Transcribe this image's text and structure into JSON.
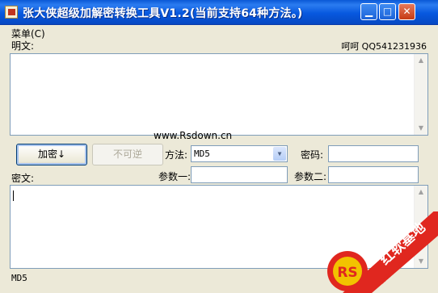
{
  "window": {
    "title": "张大侠超级加解密转换工具V1.2(当前支持64种方法。)"
  },
  "menu": {
    "label": "菜单(C)"
  },
  "plaintext": {
    "label": "明文:",
    "contact": "呵呵 QQ541231936",
    "value": ""
  },
  "watermark": {
    "text": "www.Rsdown.cn"
  },
  "toolbar": {
    "encrypt_button": "加密↓",
    "irreversible_button": "不可逆",
    "method_label": "方法:",
    "method_value": "MD5",
    "password_label": "密码:",
    "param1_label": "参数一:",
    "param2_label": "参数二:"
  },
  "ciphertext": {
    "label": "密文:",
    "value": ""
  },
  "status": {
    "text": "MD5"
  },
  "logo": {
    "brand_cn": "红软基地",
    "url": "www.rsdown.cn"
  },
  "colors": {
    "titlebar": "#0758df",
    "logo_red": "#e0271f",
    "logo_yellow": "#f2c300"
  }
}
